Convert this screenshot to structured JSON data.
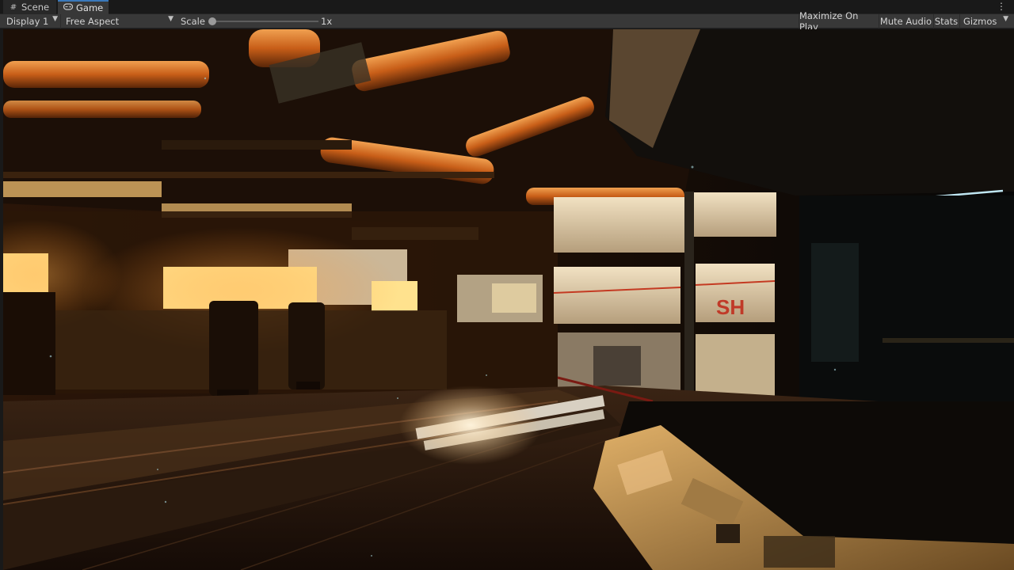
{
  "tabs": [
    {
      "label": "Scene",
      "icon": "hash-icon"
    },
    {
      "label": "Game",
      "icon": "gamepad-icon",
      "active": true
    }
  ],
  "toolbar": {
    "display": "Display 1",
    "aspect": "Free Aspect",
    "scale_label": "Scale",
    "scale_value": "1x",
    "maximize_on_play": "Maximize On Play",
    "mute_audio": "Mute Audio",
    "stats": "Stats",
    "gizmos": "Gizmos"
  },
  "scene": {
    "wall_lettering": "SH"
  },
  "colors": {
    "accent_tab": "#3a79bb",
    "panel_bg": "#383838",
    "warm_light": "#ffd27a",
    "pipe_orange": "#d8701e"
  }
}
